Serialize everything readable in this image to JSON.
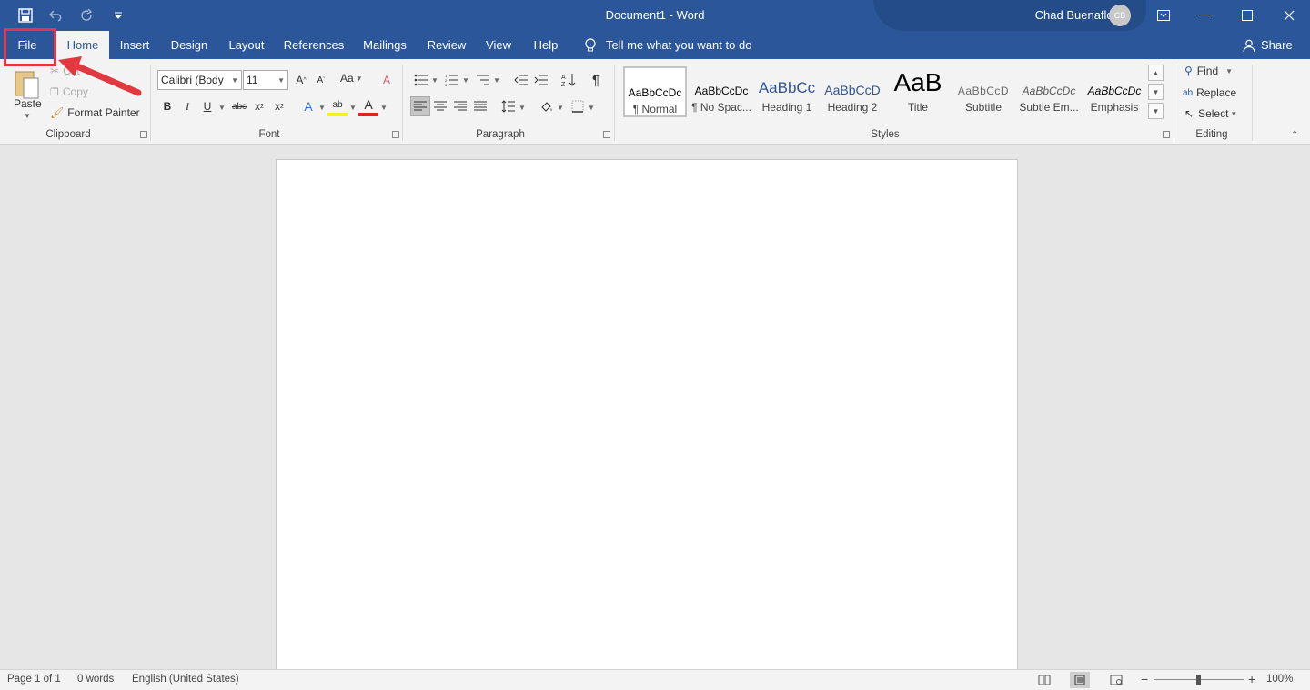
{
  "window": {
    "doc_title": "Document1  -  Word",
    "user_name": "Chad Buenaflor",
    "user_initials": "CB",
    "accent": "#2b579a"
  },
  "tabs": [
    "File",
    "Home",
    "Insert",
    "Design",
    "Layout",
    "References",
    "Mailings",
    "Review",
    "View",
    "Help"
  ],
  "active_tab": "Home",
  "tell_me": "Tell me what you want to do",
  "share": "Share",
  "clipboard": {
    "paste": "Paste",
    "cut": "Cut",
    "copy": "Copy",
    "format_painter": "Format Painter",
    "label": "Clipboard"
  },
  "font": {
    "font_name": "Calibri (Body",
    "font_size": "11",
    "change_case": "Aa",
    "label": "Font"
  },
  "paragraph": {
    "label": "Paragraph"
  },
  "styles": {
    "label": "Styles",
    "items": [
      {
        "preview": "AaBbCcDc",
        "name": "¶ Normal"
      },
      {
        "preview": "AaBbCcDc",
        "name": "¶ No Spac..."
      },
      {
        "preview": "AaBbCc",
        "name": "Heading 1"
      },
      {
        "preview": "AaBbCcD",
        "name": "Heading 2"
      },
      {
        "preview": "AaB",
        "name": "Title"
      },
      {
        "preview": "AaBbCcD",
        "name": "Subtitle"
      },
      {
        "preview": "AaBbCcDc",
        "name": "Subtle Em..."
      },
      {
        "preview": "AaBbCcDc",
        "name": "Emphasis"
      }
    ]
  },
  "editing": {
    "find": "Find",
    "replace": "Replace",
    "select": "Select",
    "label": "Editing"
  },
  "status": {
    "page": "Page 1 of 1",
    "words": "0 words",
    "language": "English (United States)",
    "zoom": "100%"
  },
  "annotation": {
    "color": "#e2383f"
  }
}
